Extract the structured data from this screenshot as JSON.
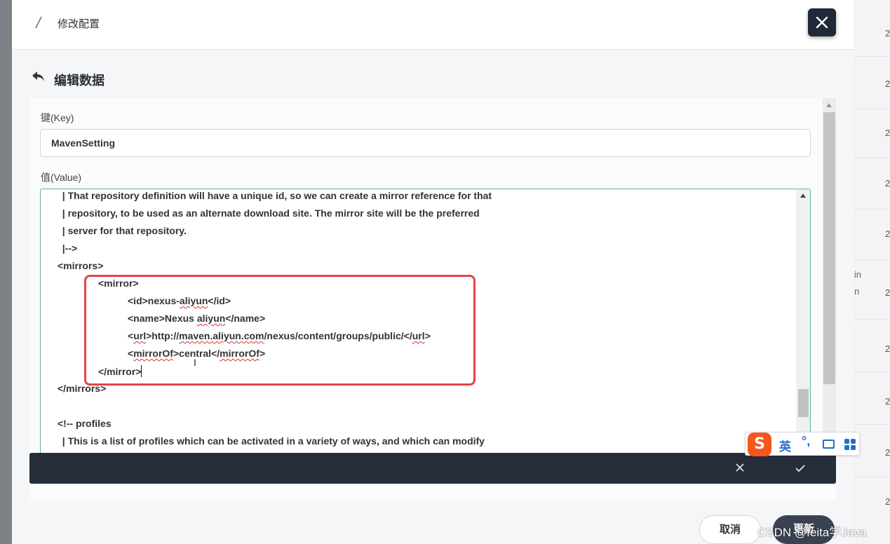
{
  "modal": {
    "title": "修改配置",
    "section_title": "编辑数据"
  },
  "form": {
    "key_label": "键(Key)",
    "key_value": "MavenSetting",
    "value_label": "值(Value)",
    "code_lines": [
      "  | That repository definition will have a unique id, so we can create a mirror reference for that",
      "  | repository, to be used as an alternate download site. The mirror site will be the preferred",
      "  | server for that repository.",
      "  |-->",
      "<mirrors>",
      "<mirror>",
      "<id>nexus-",
      "aliyun",
      "</id>",
      "<name>Nexus ",
      "aliyun",
      "</name>",
      "<",
      "url",
      ">http://",
      "maven.aliyun.com",
      "/nexus/content/groups/public/</",
      "url",
      ">",
      "<",
      "mirrorOf",
      ">central</",
      "mirrorOf",
      ">",
      "</mirror>",
      "</mirrors>",
      "<!-- profiles",
      "  | This is a list of profiles which can be activated in a variety of ways, and which can modify"
    ],
    "cursor_glyph": "I"
  },
  "buttons": {
    "cancel": "取消",
    "update": "更新"
  },
  "ime": {
    "logo": "S",
    "language": "英",
    "punct": "°,"
  },
  "background": {
    "row_digit": "2",
    "frag_1": "in",
    "frag_2": "n"
  },
  "watermark": "CSDN @feita学Java"
}
